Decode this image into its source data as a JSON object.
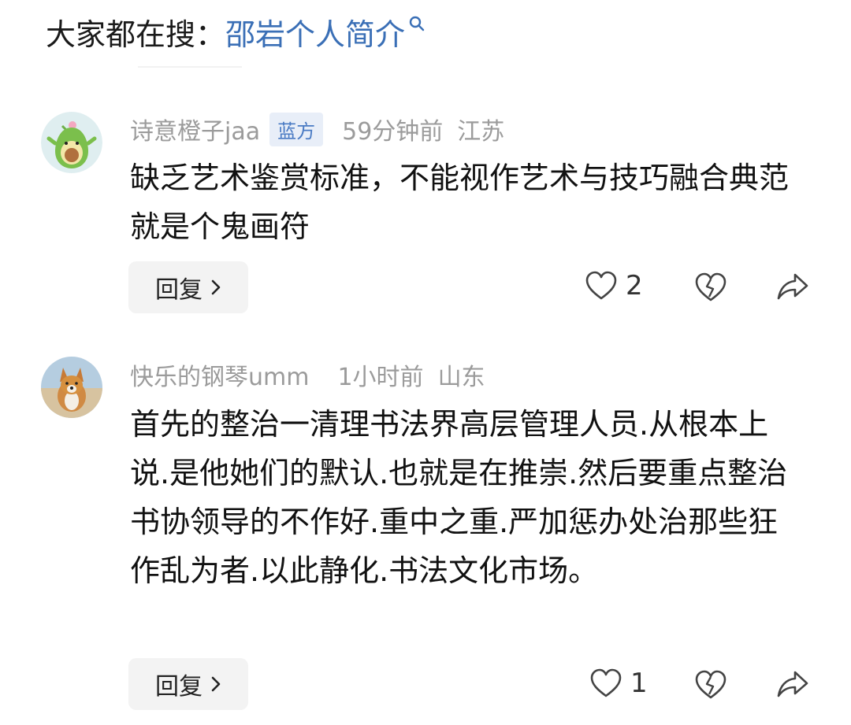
{
  "search": {
    "prefix": "大家都在搜：",
    "query": "邵岩个人简介"
  },
  "comments": [
    {
      "username": "诗意橙子jaa",
      "badge": "蓝方",
      "time": "59分钟前",
      "location": "江苏",
      "text": "缺乏艺术鉴赏标准，不能视作艺术与技巧融合典范就是个鬼画符",
      "avatar": "avocado-avatar",
      "reply_label": "回复",
      "like_count": "2"
    },
    {
      "username": "快乐的钢琴umm",
      "badge": "",
      "time": "1小时前",
      "location": "山东",
      "text": "首先的整治一清理书法界高层管理人员.从根本上说.是他她们的默认.也就是在推崇.然后要重点整治书协领导的不作好.重中之重.严加惩办处治那些狂作乱为者.以此静化.书法文化市场。",
      "avatar": "corgi-avatar",
      "reply_label": "回复",
      "like_count": "1"
    }
  ],
  "colors": {
    "link": "#3a6fb6",
    "meta": "#9b9b9b",
    "badge_bg": "#e8eef8",
    "badge_text": "#4a7bc4"
  }
}
